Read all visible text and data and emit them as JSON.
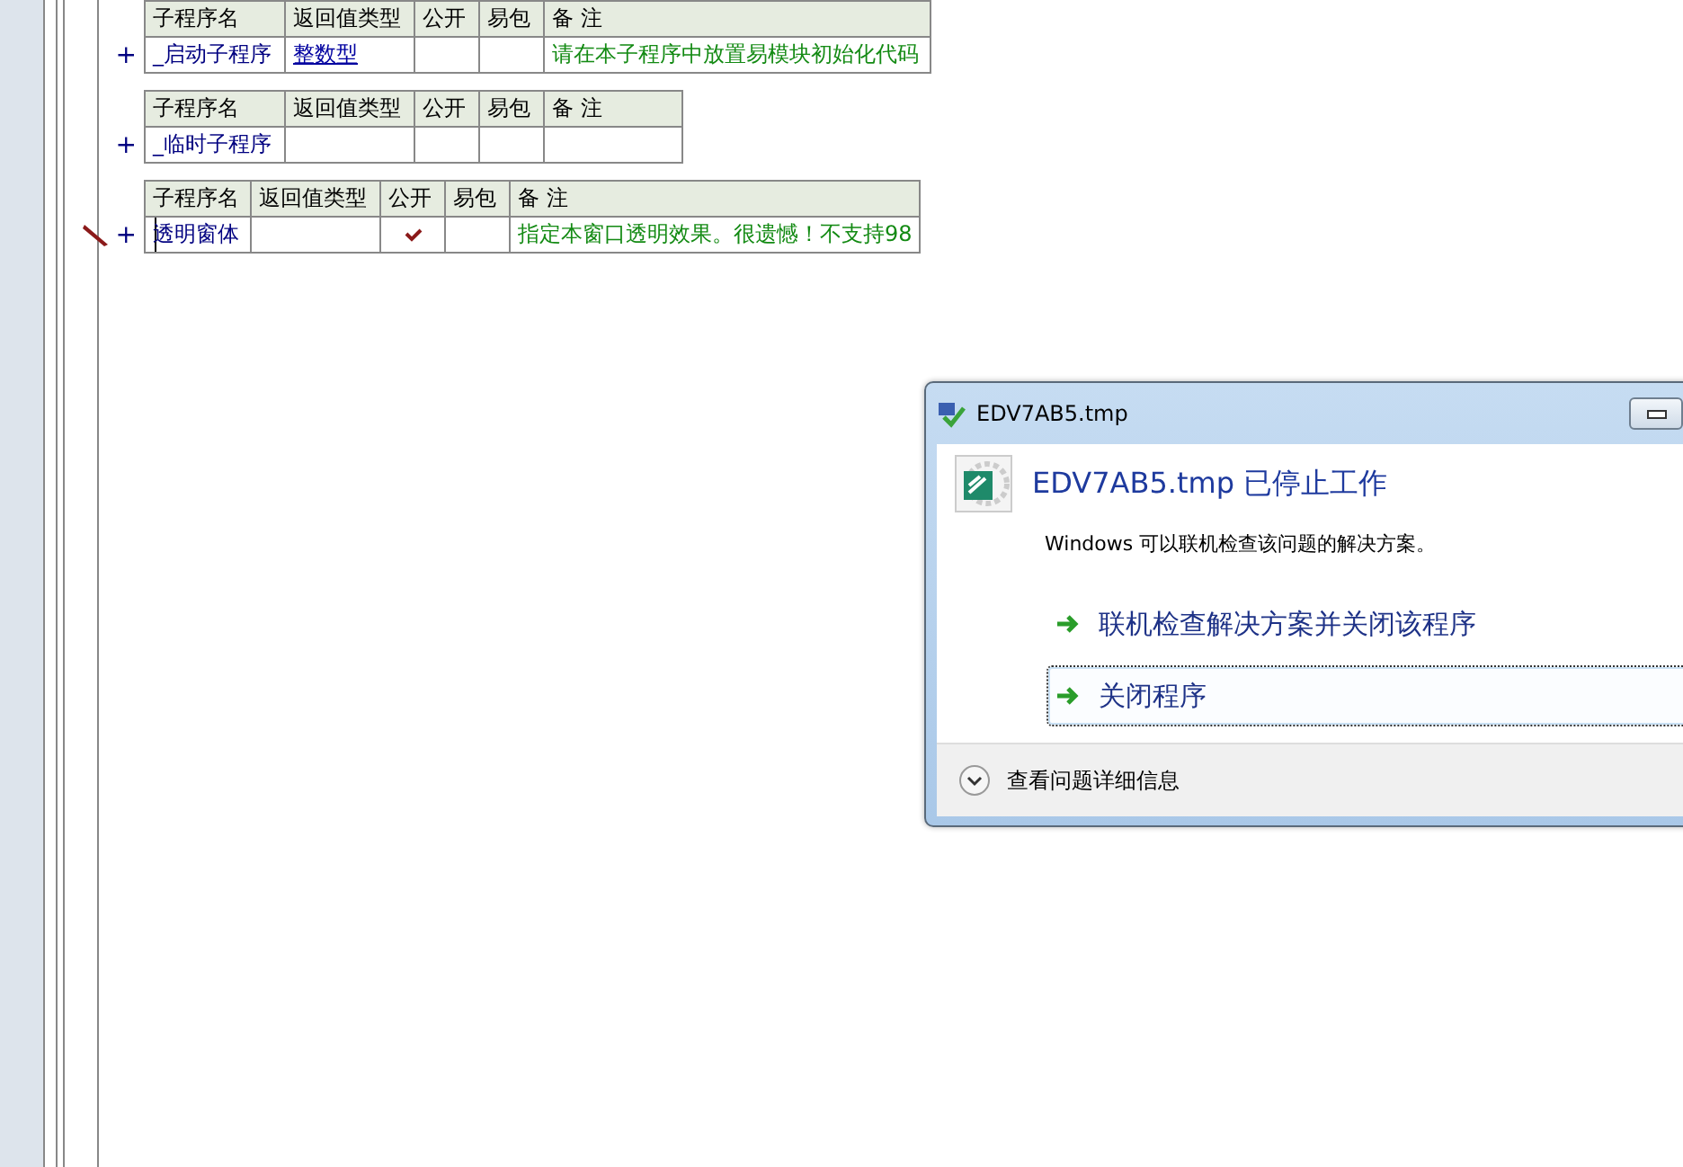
{
  "procedures": [
    {
      "columns": [
        "子程序名",
        "返回值类型",
        "公开",
        "易包",
        "备 注"
      ],
      "row": {
        "name": "_启动子程序",
        "return_type": "整数型",
        "public": false,
        "remark": "请在本子程序中放置易模块初始化代码"
      },
      "editing": false,
      "expand": "+"
    },
    {
      "columns": [
        "子程序名",
        "返回值类型",
        "公开",
        "易包",
        "备 注"
      ],
      "row": {
        "name": "_临时子程序",
        "public": false
      },
      "editing": false,
      "expand": "+"
    },
    {
      "columns": [
        "子程序名",
        "返回值类型",
        "公开",
        "易包",
        "备 注"
      ],
      "row": {
        "name": "透明窗体",
        "public": true,
        "remark": "指定本窗口透明效果。很遗憾！不支持98"
      },
      "editing": true,
      "expand": "+"
    }
  ],
  "dialog": {
    "title": "EDV7AB5.tmp",
    "heading": "EDV7AB5.tmp 已停止工作",
    "message": "Windows 可以联机检查该问题的解决方案。",
    "options": [
      {
        "label": "联机检查解决方案并关闭该程序",
        "selected": false
      },
      {
        "label": "关闭程序",
        "selected": true
      }
    ],
    "details": "查看问题详细信息"
  }
}
